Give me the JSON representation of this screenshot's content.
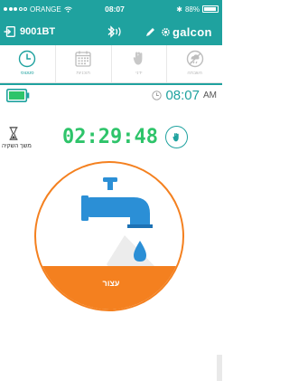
{
  "status_bar": {
    "carrier": "ORANGE",
    "time": "08:07",
    "battery": "88%"
  },
  "header": {
    "device_name": "9001BT",
    "brand": "galcon"
  },
  "tabs": [
    {
      "label": "סטטוס",
      "icon": "clock-icon",
      "active": true
    },
    {
      "label": "תוכניות",
      "icon": "calendar-icon",
      "active": false
    },
    {
      "label": "ידני",
      "icon": "hand-icon",
      "active": false
    },
    {
      "label": "השבתה",
      "icon": "rain-off-icon",
      "active": false
    }
  ],
  "status": {
    "current_time": "08:07",
    "ampm": "AM",
    "duration_label": "משך השקיה",
    "countdown": "02:29:48",
    "stop_label": "עצור"
  },
  "colors": {
    "teal": "#1fa29f",
    "orange": "#f4801f",
    "green": "#2ec46a",
    "blue": "#2b8fd6"
  }
}
